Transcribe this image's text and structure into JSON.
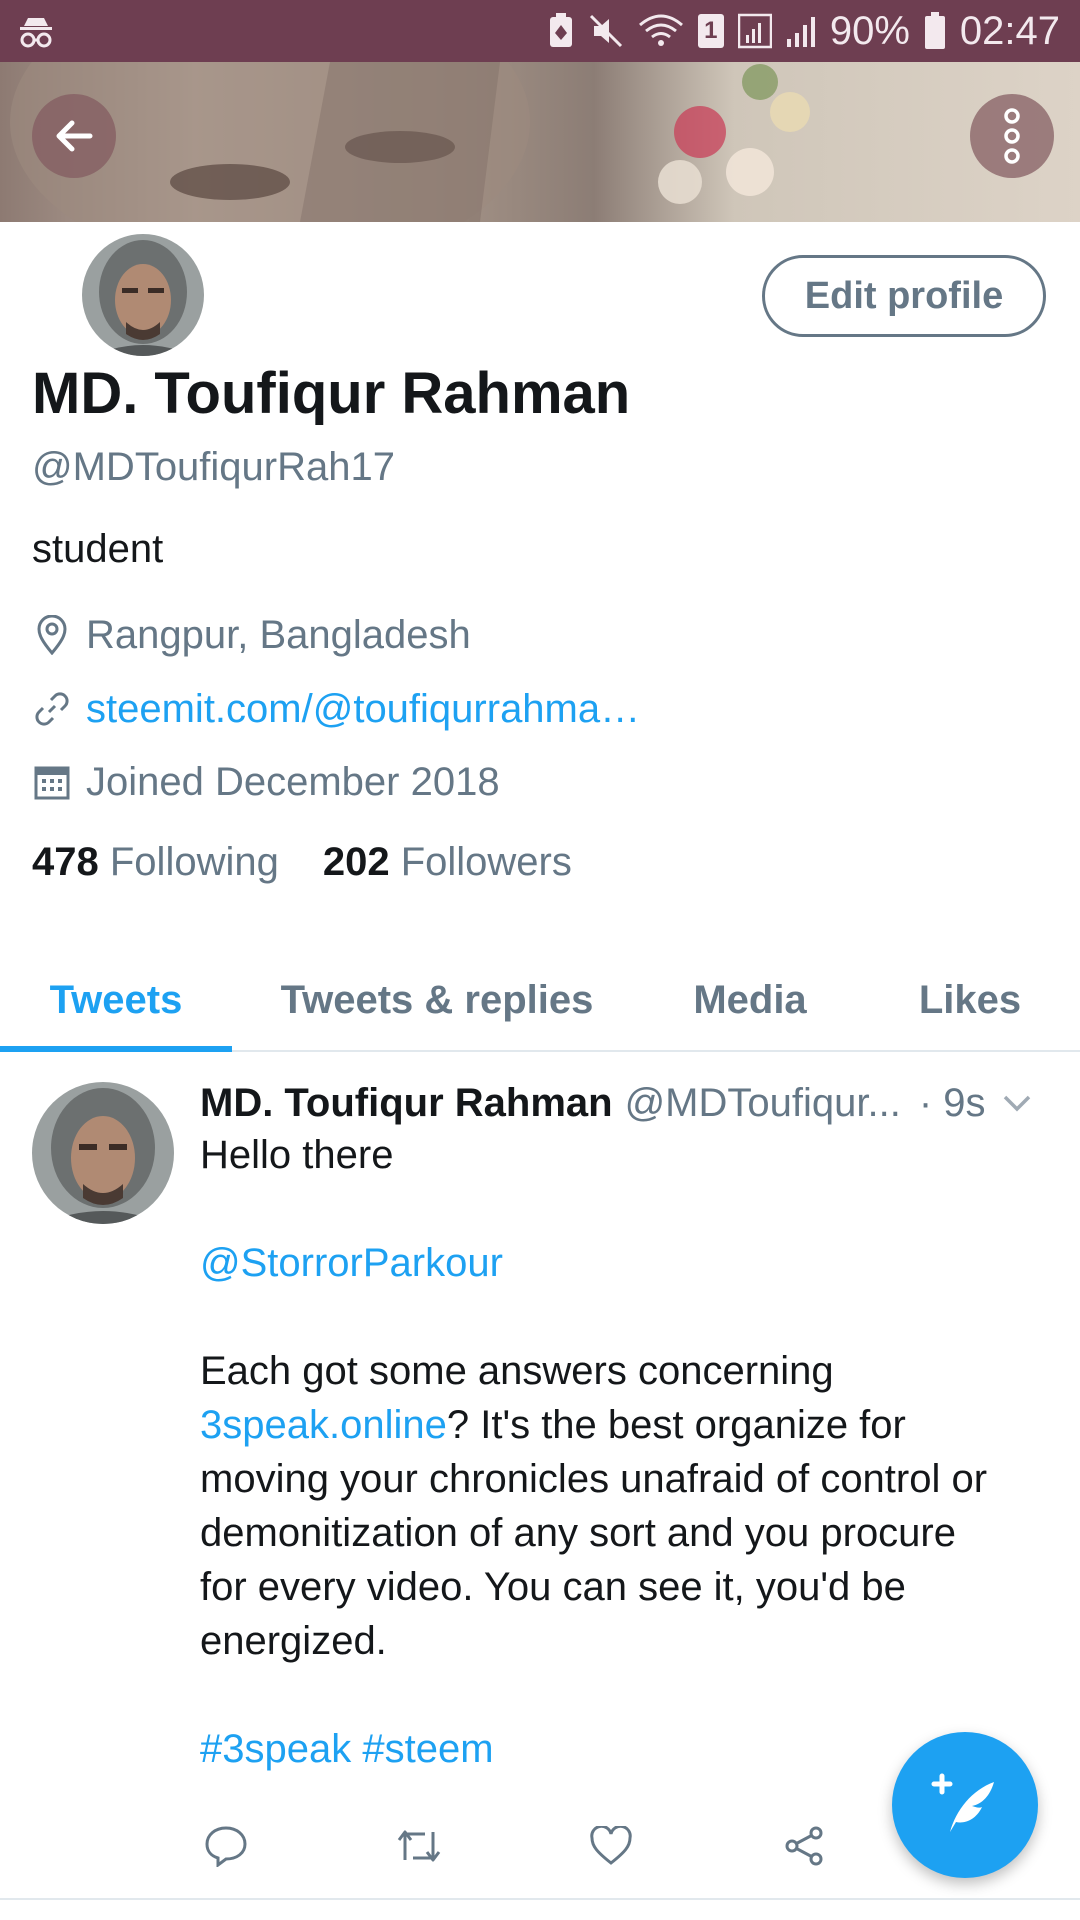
{
  "status_bar": {
    "battery_percent": "90%",
    "time": "02:47",
    "sim_slot": "1"
  },
  "header": {
    "back_icon": "arrow-left-icon",
    "more_icon": "more-vertical-icon"
  },
  "profile": {
    "edit_label": "Edit profile",
    "name": "MD. Toufiqur Rahman",
    "handle": "@MDToufiqurRah17",
    "bio": "student",
    "location": "Rangpur, Bangladesh",
    "link": "steemit.com/@toufiqurrahma…",
    "joined": "Joined December 2018",
    "following_count": "478",
    "following_label": "Following",
    "followers_count": "202",
    "followers_label": "Followers"
  },
  "tabs": [
    {
      "label": "Tweets",
      "active": true
    },
    {
      "label": "Tweets & replies",
      "active": false
    },
    {
      "label": "Media",
      "active": false
    },
    {
      "label": "Likes",
      "active": false
    }
  ],
  "tweet": {
    "name": "MD. Toufiqur Rahman",
    "handle": "@MDToufiqur...",
    "time": "· 9s",
    "line1": "Hello there",
    "mention": "@StorrorParkour",
    "line3": "Each got some answers concerning",
    "link_text": "3speak.online",
    "line4_rest": "? It's the best organize for",
    "line5": "moving your chronicles unafraid of control or",
    "line6": "demonitization of any sort and you procure",
    "line7": "for every video. You can see it, you'd be",
    "line8": "energized.",
    "hashtags": "#3speak #steem"
  },
  "colors": {
    "accent": "#1da1f2",
    "status_bar": "#6e3e51",
    "secondary_text": "#657786"
  }
}
